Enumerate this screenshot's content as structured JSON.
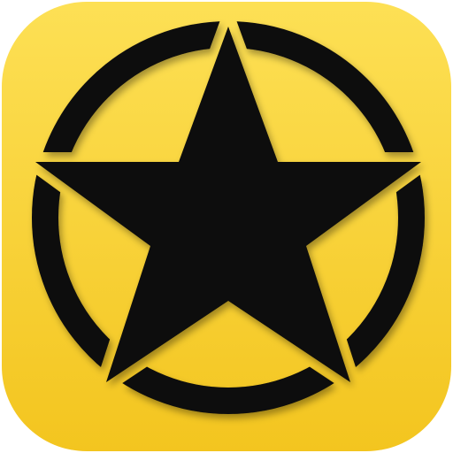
{
  "icon": {
    "name": "military-star-emblem",
    "background_gradient": [
      "#FDE055",
      "#F3C51F"
    ],
    "symbol_color": "#0A0A0A",
    "symbol": "star-in-circle"
  }
}
